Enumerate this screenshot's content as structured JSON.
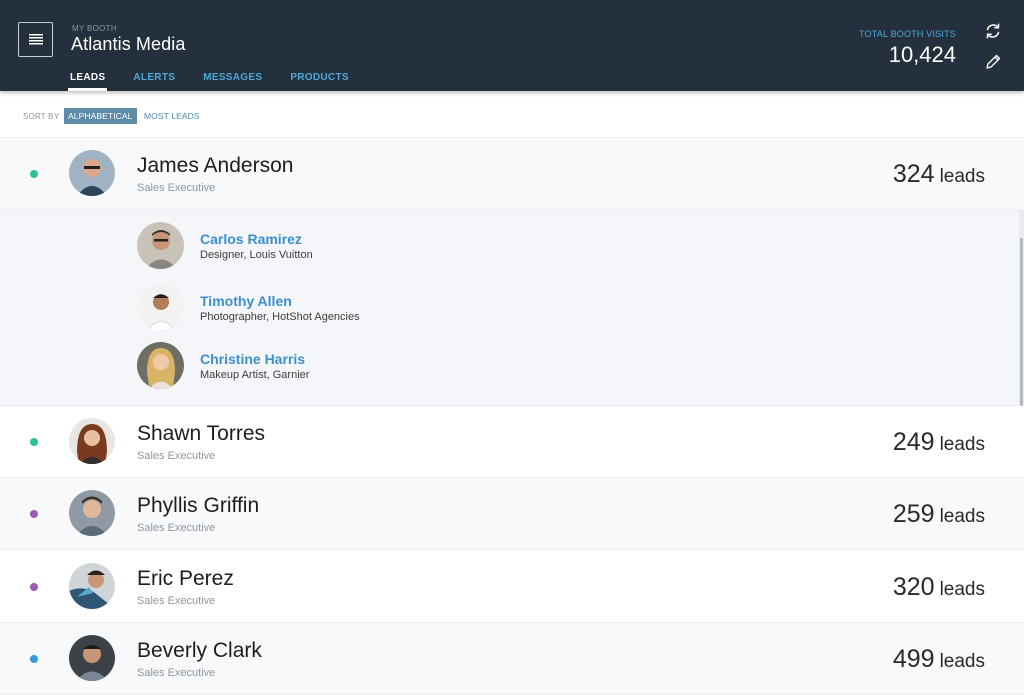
{
  "header": {
    "kicker": "MY BOOTH",
    "title": "Atlantis Media",
    "tabs": [
      {
        "label": "LEADS",
        "active": true
      },
      {
        "label": "ALERTS",
        "active": false
      },
      {
        "label": "MESSAGES",
        "active": false
      },
      {
        "label": "PRODUCTS",
        "active": false
      }
    ],
    "visits_label": "TOTAL BOOTH VISITS",
    "visits_value": "10,424",
    "icons": {
      "menu": "menu-icon",
      "refresh": "refresh-icon",
      "edit": "pencil-icon"
    }
  },
  "sort": {
    "label": "SORT BY",
    "options": [
      {
        "label": "ALPHABETICAL",
        "active": true
      },
      {
        "label": "MOST LEADS",
        "active": false
      }
    ]
  },
  "executives": [
    {
      "name": "James Anderson",
      "role": "Sales Executive",
      "leads": "324",
      "leads_unit": "leads",
      "dot_color": "#2cc197",
      "avatar_color": "#4a6076"
    },
    {
      "name": "Shawn Torres",
      "role": "Sales Executive",
      "leads": "249",
      "leads_unit": "leads",
      "dot_color": "#2cc197",
      "avatar_color": "#8a5a44"
    },
    {
      "name": "Phyllis Griffin",
      "role": "Sales Executive",
      "leads": "259",
      "leads_unit": "leads",
      "dot_color": "#9b59b6",
      "avatar_color": "#6a7d8e"
    },
    {
      "name": "Eric Perez",
      "role": "Sales Executive",
      "leads": "320",
      "leads_unit": "leads",
      "dot_color": "#9b59b6",
      "avatar_color": "#3b5e7c"
    },
    {
      "name": "Beverly Clark",
      "role": "Sales Executive",
      "leads": "499",
      "leads_unit": "leads",
      "dot_color": "#3498db",
      "avatar_color": "#3a3f45"
    }
  ],
  "expanded_leads": [
    {
      "name": "Carlos Ramirez",
      "detail": "Designer, Louis Vuitton",
      "avatar_color": "#6b5646"
    },
    {
      "name": "Timothy Allen",
      "detail": "Photographer, HotShot Agencies",
      "avatar_color": "#e8e8e8"
    },
    {
      "name": "Christine Harris",
      "detail": "Makeup Artist, Garnier",
      "avatar_color": "#c9a35a"
    }
  ]
}
